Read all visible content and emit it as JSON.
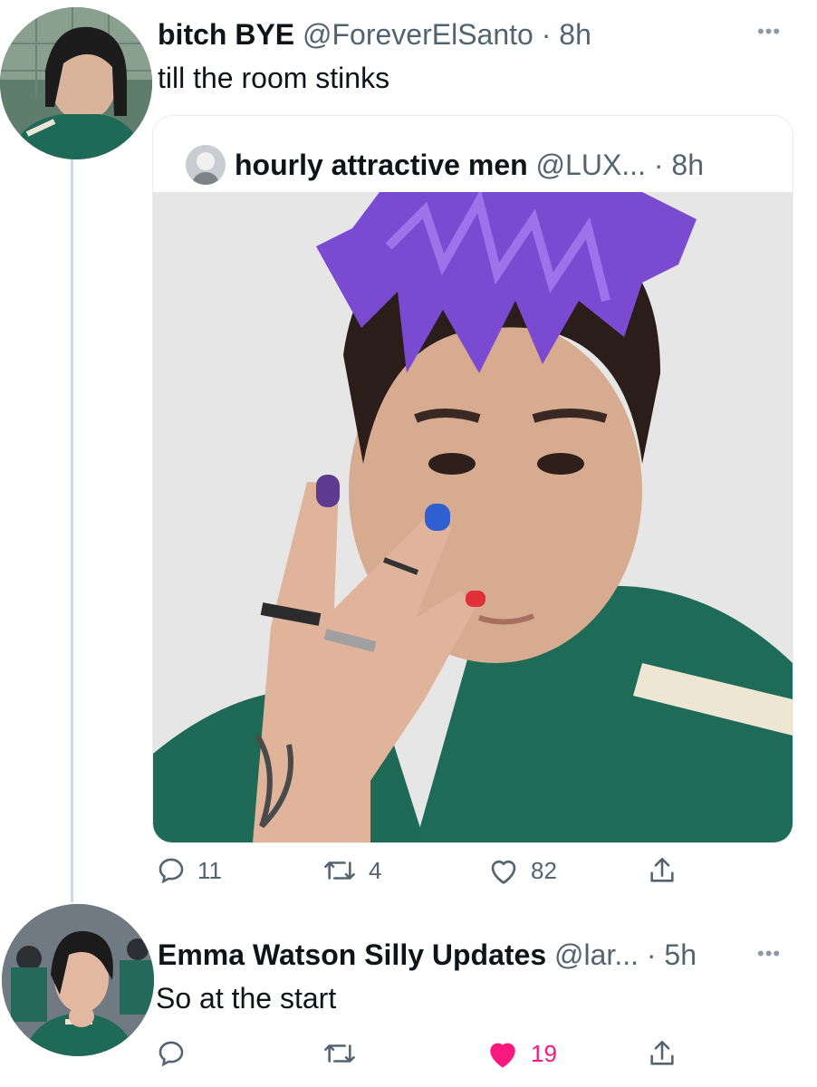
{
  "tweet1": {
    "display_name": "bitch BYE",
    "meta": "@ForeverElSanto · 8h",
    "text": "till the room stinks",
    "more_icon": "more-horizontal-icon",
    "quote": {
      "display_name": "hourly attractive men",
      "meta": "@LUX... · 8h",
      "image_alt": "photo"
    },
    "actions": {
      "reply_count": "11",
      "retweet_count": "4",
      "like_count": "82"
    }
  },
  "tweet2": {
    "display_name": "Emma Watson Silly Updates",
    "meta": "@lar... · 5h",
    "text": "So at the start",
    "more_icon": "more-horizontal-icon",
    "actions": {
      "like_count": "19",
      "liked": true
    }
  },
  "colors": {
    "text": "#0f1419",
    "secondary": "#536471",
    "like_active": "#f91880",
    "border": "#e6ecf0",
    "thread_line": "#cfd9de"
  }
}
